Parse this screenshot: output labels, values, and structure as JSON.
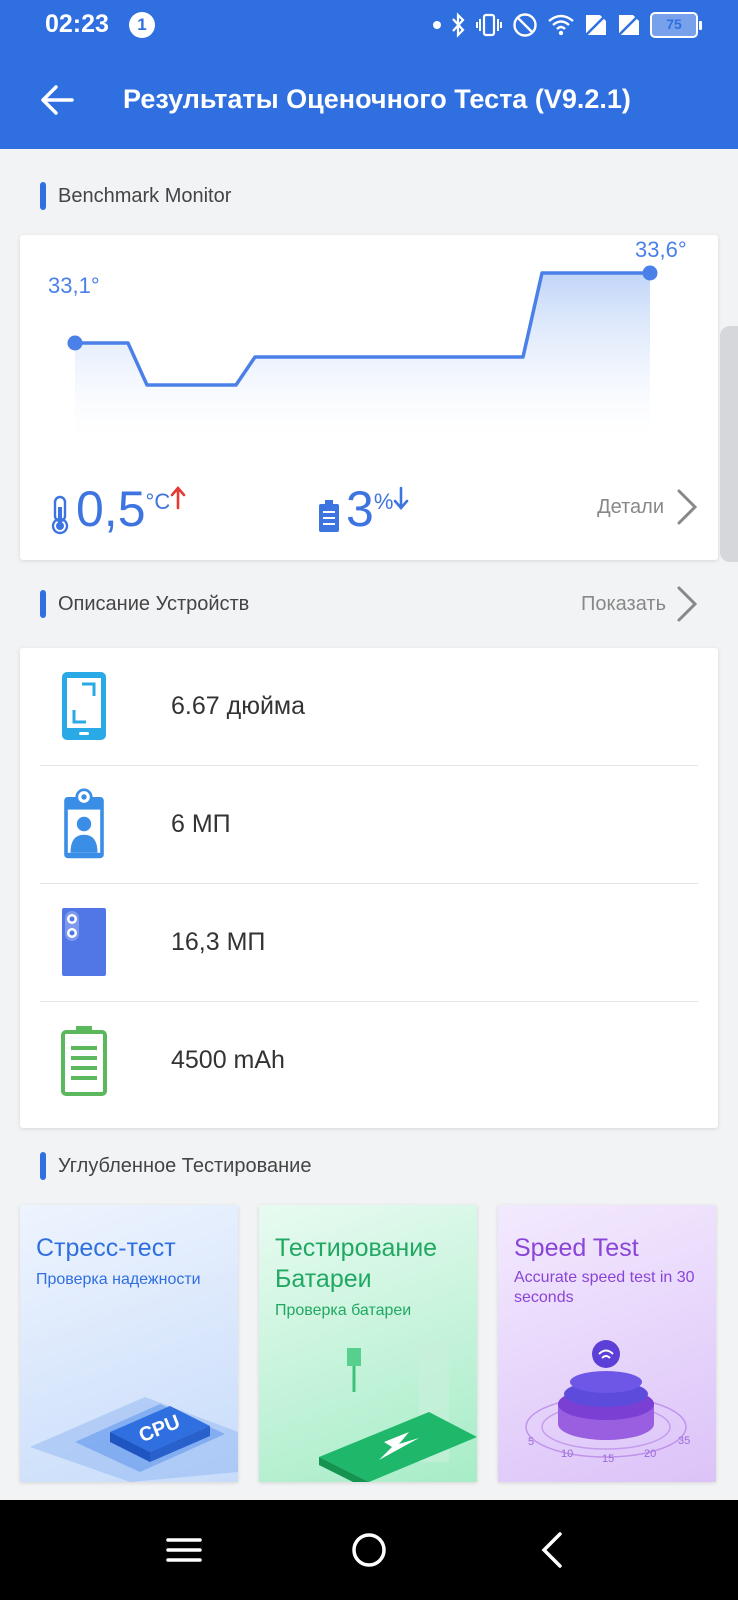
{
  "status_bar": {
    "time": "02:23",
    "notification_count": "1",
    "battery": "75"
  },
  "app_bar": {
    "title": "Результаты Оценочного Теста (V9.2.1)",
    "back_icon": "arrow-left-icon"
  },
  "monitor": {
    "section_label": "Benchmark Monitor",
    "temp_start_label": "33,1°",
    "temp_end_label": "33,6°",
    "temp_change": "0,5",
    "temp_unit": "°C",
    "battery_change": "3",
    "battery_unit": "%",
    "details_label": "Детали"
  },
  "chart_data": {
    "type": "line",
    "title": "",
    "xlabel": "",
    "ylabel": "",
    "grid": false,
    "series": [
      {
        "values": [
          33.1,
          33.1,
          32.8,
          32.8,
          33.0,
          33.0,
          33.6,
          33.6
        ]
      }
    ],
    "annotations": [
      "33,1°",
      "33,6°"
    ]
  },
  "devices": {
    "section_label": "Описание Устройств",
    "show_label": "Показать",
    "items": [
      {
        "icon": "phone-screen-icon",
        "text": "6.67 дюйма"
      },
      {
        "icon": "front-camera-icon",
        "text": "6 МП"
      },
      {
        "icon": "rear-camera-icon",
        "text": "16,3 МП"
      },
      {
        "icon": "battery-capacity-icon",
        "text": "4500 mAh"
      }
    ]
  },
  "deep_tests": {
    "section_label": "Углубленное Тестирование",
    "cards": [
      {
        "title": "Стресс-тест",
        "subtitle": "Проверка надежности",
        "art_label": "CPU"
      },
      {
        "title": "Тестирование Батареи",
        "subtitle": "Проверка батареи"
      },
      {
        "title": "Speed Test",
        "subtitle": "Accurate speed test in 30 seconds",
        "dial_ticks": [
          "5",
          "10",
          "15",
          "20",
          "35"
        ]
      }
    ]
  },
  "colors": {
    "accent": "#2f6fe0",
    "chart_line": "#4a80e8",
    "battery_green": "#5cb85c",
    "temp_up": "#e53935"
  }
}
